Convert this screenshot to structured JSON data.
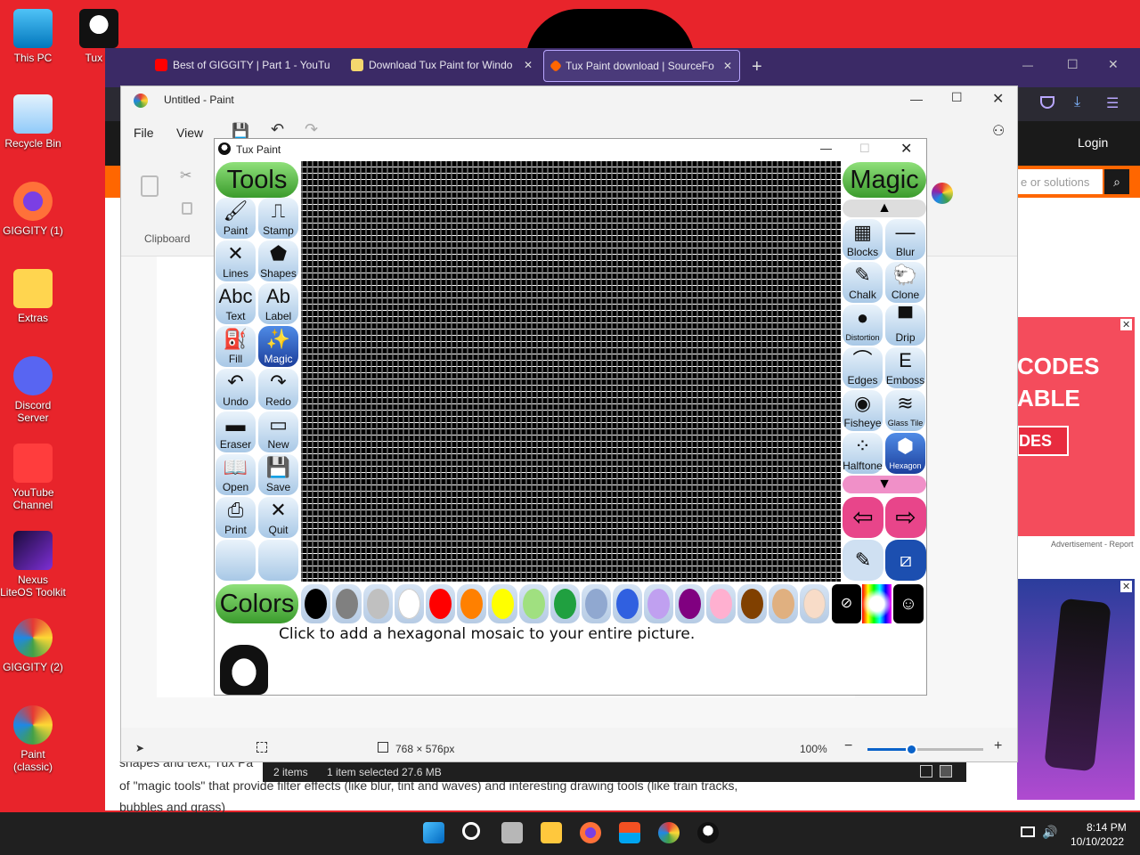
{
  "desktop": {
    "icons": [
      {
        "label": "This PC"
      },
      {
        "label": "Tux P"
      },
      {
        "label": "Recycle Bin"
      },
      {
        "label": "GIGGITY (1)"
      },
      {
        "label": "Extras"
      },
      {
        "label": "Discord Server"
      },
      {
        "label": "YouTube Channel"
      },
      {
        "label": "Nexus LiteOS Toolkit"
      },
      {
        "label": "GIGGITY (2)"
      },
      {
        "label": "Paint (classic)"
      }
    ]
  },
  "browser": {
    "tabs": [
      {
        "label": "Best of GIGGITY | Part 1 - YouTu",
        "close": "✕"
      },
      {
        "label": "Download Tux Paint for Windo",
        "close": "✕"
      },
      {
        "label": "Tux Paint download | SourceFo",
        "close": "✕"
      }
    ],
    "new_tab": "+",
    "window_controls": {
      "minimize": "—",
      "maximize": "☐",
      "close": "✕"
    },
    "page": {
      "login": "Login",
      "search_placeholder": "e or solutions",
      "ad_text_1": "CODES",
      "ad_text_2": "ABLE",
      "ad_text_3": "DES",
      "ad_label": "Advertisement - Report",
      "body_text_1": "shapes and text, Tux Pa",
      "body_text_2": "of \"magic tools\" that provide filter effects (like blur, tint and waves) and interesting drawing tools (like train tracks,",
      "body_text_3": "bubbles and grass)"
    }
  },
  "paint": {
    "title": "Untitled - Paint",
    "menu": [
      "File",
      "View"
    ],
    "clipboard_label": "Clipboard",
    "status": {
      "dimensions": "768 × 576px",
      "zoom": "100%"
    }
  },
  "explorer_status": {
    "items": "2 items",
    "selected": "1 item selected  27.6 MB"
  },
  "tuxpaint": {
    "title": "Tux Paint",
    "tools_header": "Tools",
    "magic_header": "Magic",
    "colors_header": "Colors",
    "tools": [
      {
        "label": "Paint",
        "glyph": "🖌"
      },
      {
        "label": "Stamp",
        "glyph": "⎍"
      },
      {
        "label": "Lines",
        "glyph": "✕"
      },
      {
        "label": "Shapes",
        "glyph": "⬟"
      },
      {
        "label": "Text",
        "glyph": "Abc"
      },
      {
        "label": "Label",
        "glyph": "Ab"
      },
      {
        "label": "Fill",
        "glyph": "⛽"
      },
      {
        "label": "Magic",
        "glyph": "✨"
      },
      {
        "label": "Undo",
        "glyph": "↶"
      },
      {
        "label": "Redo",
        "glyph": "↷"
      },
      {
        "label": "Eraser",
        "glyph": "▬"
      },
      {
        "label": "New",
        "glyph": "▭"
      },
      {
        "label": "Open",
        "glyph": "📖"
      },
      {
        "label": "Save",
        "glyph": "💾"
      },
      {
        "label": "Print",
        "glyph": "⎙"
      },
      {
        "label": "Quit",
        "glyph": "✕"
      }
    ],
    "magic_tools": [
      {
        "label": "Blocks",
        "glyph": "▦"
      },
      {
        "label": "Blur",
        "glyph": "—"
      },
      {
        "label": "Chalk",
        "glyph": "✎"
      },
      {
        "label": "Clone",
        "glyph": "🐑"
      },
      {
        "label": "Distortion",
        "glyph": "●"
      },
      {
        "label": "Drip",
        "glyph": "▀"
      },
      {
        "label": "Edges",
        "glyph": "⌒"
      },
      {
        "label": "Emboss",
        "glyph": "E"
      },
      {
        "label": "Fisheye",
        "glyph": "◉"
      },
      {
        "label": "Glass Tile",
        "glyph": "≋"
      },
      {
        "label": "Halftone",
        "glyph": "⁘"
      },
      {
        "label": "Hexagon Mosaic",
        "glyph": "⬢"
      }
    ],
    "selected_tool": "Magic",
    "selected_magic": "Hexagon Mosaic",
    "hint": "Click to add a hexagonal mosaic to your entire picture.",
    "colors": [
      "#000000",
      "#808080",
      "#c0c0c0",
      "#ffffff",
      "#ff0000",
      "#ff8000",
      "#ffff00",
      "#a0e080",
      "#20a040",
      "#90a8d0",
      "#3060e0",
      "#c0a0f0",
      "#800080",
      "#ffb0d0",
      "#804000",
      "#e0b080",
      "#f8dcc8"
    ]
  },
  "taskbar": {
    "time": "8:14 PM",
    "date": "10/10/2022"
  }
}
